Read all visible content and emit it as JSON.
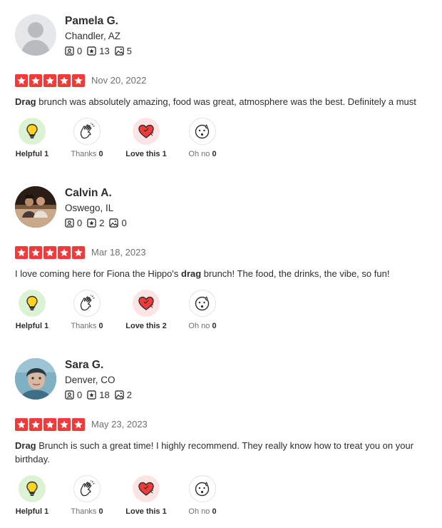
{
  "reviews": [
    {
      "name": "Pamela G.",
      "location": "Chandler, AZ",
      "friends": "0",
      "reviews_count": "13",
      "photos": "5",
      "rating": 5,
      "date": "Nov 20, 2022",
      "text_bold": "Drag",
      "text_rest": " brunch was absolutely amazing, food was great, atmosphere was the best. Definitely a must",
      "avatar": "default",
      "reactions": {
        "helpful": "1",
        "thanks": "0",
        "love": "1",
        "ohno": "0"
      }
    },
    {
      "name": "Calvin A.",
      "location": "Oswego, IL",
      "friends": "0",
      "reviews_count": "2",
      "photos": "0",
      "rating": 5,
      "date": "Mar 18, 2023",
      "text_pre": "I love coming here for Fiona the Hippo's ",
      "text_bold": "drag",
      "text_rest": " brunch! The food, the drinks, the vibe, so fun!",
      "avatar": "photo",
      "reactions": {
        "helpful": "1",
        "thanks": "0",
        "love": "2",
        "ohno": "0"
      }
    },
    {
      "name": "Sara G.",
      "location": "Denver, CO",
      "friends": "0",
      "reviews_count": "18",
      "photos": "2",
      "rating": 5,
      "date": "May 23, 2023",
      "text_bold": "Drag",
      "text_rest": " Brunch is such a great time! I highly recommend. They really know how to treat you on your birthday.",
      "avatar": "photo",
      "reactions": {
        "helpful": "1",
        "thanks": "0",
        "love": "1",
        "ohno": "0"
      }
    }
  ],
  "labels": {
    "helpful": "Helpful",
    "thanks": "Thanks",
    "love": "Love this",
    "ohno": "Oh no"
  },
  "colors": {
    "star": "#f43939",
    "helpful_bg": "#dcf3d3",
    "love_bg": "#fde4e4",
    "text": "#2d2e2f",
    "muted": "#6e7072"
  },
  "icons": {
    "friends": "friends-icon",
    "reviews": "review-star-icon",
    "photos": "photo-icon",
    "helpful": "lightbulb-icon",
    "thanks": "clapping-hands-icon",
    "love": "heart-icon",
    "ohno": "oh-no-face-icon"
  }
}
